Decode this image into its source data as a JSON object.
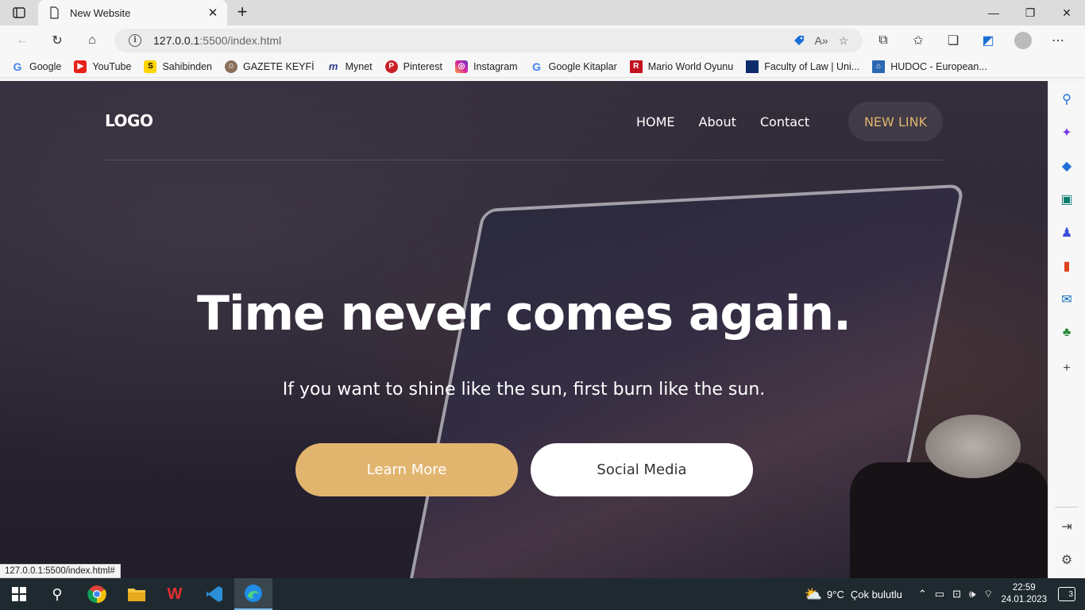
{
  "browser": {
    "tab": {
      "title": "New Website"
    },
    "address": {
      "host": "127.0.0.1",
      "path": ":5500/index.html"
    },
    "favorites": [
      {
        "label": "Google",
        "icon": "google-icon",
        "color": "#4285f4"
      },
      {
        "label": "YouTube",
        "icon": "youtube-icon",
        "color": "#e62117"
      },
      {
        "label": "Sahibinden",
        "icon": "sahibinden-icon",
        "color": "#ffd400"
      },
      {
        "label": "GAZETE KEYFİ",
        "icon": "gazete-icon",
        "color": "#8a6f5a"
      },
      {
        "label": "Mynet",
        "icon": "mynet-icon",
        "color": "#2f3f8a"
      },
      {
        "label": "Pinterest",
        "icon": "pinterest-icon",
        "color": "#cb1f27"
      },
      {
        "label": "Instagram",
        "icon": "instagram-icon",
        "color": "#d6249f"
      },
      {
        "label": "Google Kitaplar",
        "icon": "google-books-icon",
        "color": "#4285f4"
      },
      {
        "label": "Mario World Oyunu",
        "icon": "mario-icon",
        "color": "#c1121f"
      },
      {
        "label": "Faculty of Law | Uni...",
        "icon": "faculty-icon",
        "color": "#0d2c6b"
      },
      {
        "label": "HUDOC - European...",
        "icon": "hudoc-icon",
        "color": "#2b67b3"
      }
    ],
    "status_url": "127.0.0.1:5500/index.html#"
  },
  "site": {
    "logo": "LOGO",
    "nav": {
      "home": "HOME",
      "about": "About",
      "contact": "Contact",
      "new_link": "NEW LINK"
    },
    "hero": {
      "title": "Time never comes again.",
      "subtitle": "If you want to shine like the sun, first burn like the sun.",
      "learn_more": "Learn More",
      "social_media": "Social Media"
    },
    "colors": {
      "accent": "#e2b56f",
      "text": "#ffffff"
    }
  },
  "taskbar": {
    "weather": {
      "temp": "9°C",
      "desc": "Çok bulutlu"
    },
    "time": "22:59",
    "date": "24.01.2023",
    "notifications": "3"
  }
}
